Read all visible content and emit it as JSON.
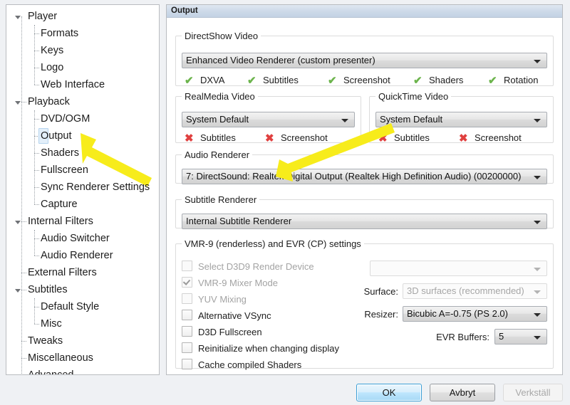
{
  "window": {
    "panel_title": "Output"
  },
  "tree": {
    "items": [
      {
        "label": "Player",
        "level": 0,
        "expander": true,
        "selected": false
      },
      {
        "label": "Formats",
        "level": 1,
        "expander": false,
        "selected": false
      },
      {
        "label": "Keys",
        "level": 1,
        "expander": false,
        "selected": false
      },
      {
        "label": "Logo",
        "level": 1,
        "expander": false,
        "selected": false
      },
      {
        "label": "Web Interface",
        "level": 1,
        "expander": false,
        "selected": false
      },
      {
        "label": "Playback",
        "level": 0,
        "expander": true,
        "selected": false
      },
      {
        "label": "DVD/OGM",
        "level": 1,
        "expander": false,
        "selected": false
      },
      {
        "label": "Output",
        "level": 1,
        "expander": false,
        "selected": true
      },
      {
        "label": "Shaders",
        "level": 1,
        "expander": false,
        "selected": false
      },
      {
        "label": "Fullscreen",
        "level": 1,
        "expander": false,
        "selected": false
      },
      {
        "label": "Sync Renderer Settings",
        "level": 1,
        "expander": false,
        "selected": false
      },
      {
        "label": "Capture",
        "level": 1,
        "expander": false,
        "selected": false
      },
      {
        "label": "Internal Filters",
        "level": 0,
        "expander": true,
        "selected": false
      },
      {
        "label": "Audio Switcher",
        "level": 1,
        "expander": false,
        "selected": false
      },
      {
        "label": "Audio Renderer",
        "level": 1,
        "expander": false,
        "selected": false
      },
      {
        "label": "External Filters",
        "level": 0,
        "expander": false,
        "selected": false
      },
      {
        "label": "Subtitles",
        "level": 0,
        "expander": true,
        "selected": false
      },
      {
        "label": "Default Style",
        "level": 1,
        "expander": false,
        "selected": false
      },
      {
        "label": "Misc",
        "level": 1,
        "expander": false,
        "selected": false
      },
      {
        "label": "Tweaks",
        "level": 0,
        "expander": false,
        "selected": false
      },
      {
        "label": "Miscellaneous",
        "level": 0,
        "expander": false,
        "selected": false
      },
      {
        "label": "Advanced",
        "level": 0,
        "expander": false,
        "selected": false
      }
    ]
  },
  "directshow": {
    "legend": "DirectShow Video",
    "renderer_value": "Enhanced Video Renderer (custom presenter)",
    "capabilities": [
      {
        "label": "DXVA",
        "state": "ok",
        "glyph": "check-icon"
      },
      {
        "label": "Subtitles",
        "state": "ok",
        "glyph": "check-icon"
      },
      {
        "label": "Screenshot",
        "state": "ok",
        "glyph": "check-icon"
      },
      {
        "label": "Shaders",
        "state": "ok",
        "glyph": "check-icon"
      },
      {
        "label": "Rotation",
        "state": "ok",
        "glyph": "check-icon"
      }
    ]
  },
  "realmedia": {
    "legend": "RealMedia Video",
    "renderer_value": "System Default",
    "capabilities": [
      {
        "label": "Subtitles",
        "state": "no",
        "glyph": "cross-icon"
      },
      {
        "label": "Screenshot",
        "state": "no",
        "glyph": "cross-icon"
      }
    ]
  },
  "quicktime": {
    "legend": "QuickTime Video",
    "renderer_value": "System Default",
    "capabilities": [
      {
        "label": "Subtitles",
        "state": "no",
        "glyph": "cross-icon"
      },
      {
        "label": "Screenshot",
        "state": "no",
        "glyph": "cross-icon"
      }
    ]
  },
  "audio_renderer": {
    "legend": "Audio Renderer",
    "value": "7: DirectSound: Realtek Digital Output (Realtek High Definition Audio) (00200000)"
  },
  "subtitle_renderer": {
    "legend": "Subtitle Renderer",
    "value": "Internal Subtitle Renderer"
  },
  "vmr9": {
    "legend": "VMR-9 (renderless) and EVR (CP) settings",
    "checkboxes": [
      {
        "label": "Select D3D9 Render Device",
        "checked": false,
        "enabled": false
      },
      {
        "label": "VMR-9 Mixer Mode",
        "checked": true,
        "enabled": false
      },
      {
        "label": "YUV Mixing",
        "checked": false,
        "enabled": false
      },
      {
        "label": "Alternative VSync",
        "checked": false,
        "enabled": true
      },
      {
        "label": "D3D Fullscreen",
        "checked": false,
        "enabled": true
      },
      {
        "label": "Reinitialize when changing display",
        "checked": false,
        "enabled": true
      },
      {
        "label": "Cache compiled Shaders",
        "checked": false,
        "enabled": true
      }
    ],
    "device_combo_value": "",
    "surface_label": "Surface:",
    "surface_value": "3D surfaces (recommended)",
    "resizer_label": "Resizer:",
    "resizer_value": "Bicubic A=-0.75 (PS 2.0)",
    "evr_buffers_label": "EVR Buffers:",
    "evr_buffers_value": "5"
  },
  "buttons": {
    "ok": "OK",
    "cancel": "Avbryt",
    "apply": "Verkställ"
  },
  "annotations": {
    "arrow_color": "#f7ec1b",
    "arrow1_target": "Output",
    "arrow2_target": "Audio Renderer combo"
  }
}
